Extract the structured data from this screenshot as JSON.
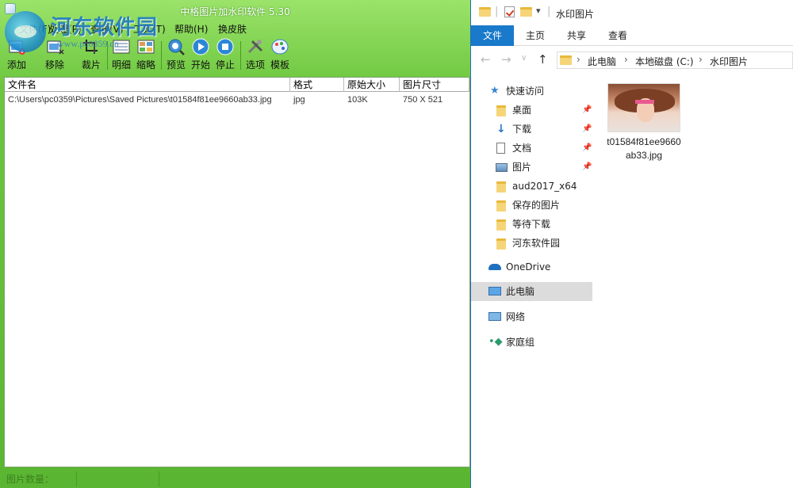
{
  "app": {
    "title": "中格图片加水印软件 5.30",
    "watermark_text": "河东软件园",
    "watermark_url": "www.pc0359.cn",
    "menu": [
      "文件(F)",
      "处理(P)",
      "查看(V)",
      "工具(T)",
      "帮助(H)",
      "换皮肤"
    ],
    "toolbar": [
      {
        "label": "添加",
        "icon": "add-image-icon"
      },
      {
        "label": "移除",
        "icon": "remove-image-icon"
      },
      {
        "label": "裁片",
        "icon": "crop-icon"
      },
      {
        "label": "明细",
        "icon": "details-view-icon"
      },
      {
        "label": "缩略",
        "icon": "thumbnail-view-icon"
      },
      {
        "label": "预览",
        "icon": "preview-icon"
      },
      {
        "label": "开始",
        "icon": "play-icon"
      },
      {
        "label": "停止",
        "icon": "stop-icon"
      },
      {
        "label": "选项",
        "icon": "options-icon"
      },
      {
        "label": "模板",
        "icon": "template-icon"
      }
    ],
    "columns": [
      "文件名",
      "格式",
      "原始大小",
      "图片尺寸"
    ],
    "rows": [
      {
        "path": "C:\\Users\\pc0359\\Pictures\\Saved Pictures\\t01584f81ee9660ab33.jpg",
        "format": "jpg",
        "size": "103K",
        "dimensions": "750 X 521"
      }
    ],
    "status": "图片数量："
  },
  "explorer": {
    "title": "水印图片",
    "tabs": [
      "文件",
      "主页",
      "共享",
      "查看"
    ],
    "breadcrumb": [
      "此电脑",
      "本地磁盘 (C:)",
      "水印图片"
    ],
    "nav": {
      "quick_access": "快速访问",
      "items": [
        {
          "label": "桌面",
          "pinned": true,
          "icon": "folder-icon"
        },
        {
          "label": "下载",
          "pinned": true,
          "icon": "download-icon"
        },
        {
          "label": "文档",
          "pinned": true,
          "icon": "document-icon"
        },
        {
          "label": "图片",
          "pinned": true,
          "icon": "pictures-icon"
        },
        {
          "label": "aud2017_x64",
          "pinned": false,
          "icon": "folder-icon"
        },
        {
          "label": "保存的图片",
          "pinned": false,
          "icon": "folder-icon"
        },
        {
          "label": "等待下载",
          "pinned": false,
          "icon": "folder-icon"
        },
        {
          "label": "河东软件园",
          "pinned": false,
          "icon": "folder-icon"
        }
      ],
      "onedrive": "OneDrive",
      "this_pc": "此电脑",
      "network": "网络",
      "homegroup": "家庭组"
    },
    "file": {
      "name": "t01584f81ee9660ab33.jpg"
    }
  }
}
